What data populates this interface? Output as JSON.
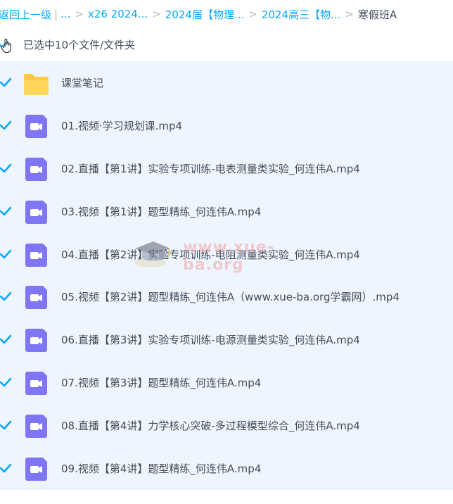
{
  "breadcrumb": {
    "back": "返回上一级",
    "ellipsis": "...",
    "items": [
      "x26 2024...",
      "2024届【物理...",
      "2024高三【物...",
      "寒假班A"
    ]
  },
  "selection": {
    "text": "已选中10个文件/文件夹"
  },
  "files": [
    {
      "name": "课堂笔记",
      "type": "folder"
    },
    {
      "name": "01.视频·学习规划课.mp4",
      "type": "video"
    },
    {
      "name": "02.直播【第1讲】实验专项训练-电表测量类实验_何连伟A.mp4",
      "type": "video"
    },
    {
      "name": "03.视频【第1讲】题型精练_何连伟A.mp4",
      "type": "video"
    },
    {
      "name": "04.直播【第2讲】实验专项训练-电阻测量类实验_何连伟A.mp4",
      "type": "video"
    },
    {
      "name": "05.视频【第2讲】题型精练_何连伟A（www.xue-ba.org学霸网）.mp4",
      "type": "video"
    },
    {
      "name": "06.直播【第3讲】实验专项训练-电源测量类实验_何连伟A.mp4",
      "type": "video"
    },
    {
      "name": "07.视频【第3讲】题型精练_何连伟A.mp4",
      "type": "video"
    },
    {
      "name": "08.直播【第4讲】力学核心突破-多过程模型综合_何连伟A.mp4",
      "type": "video"
    },
    {
      "name": "09.视频【第4讲】题型精练_何连伟A.mp4",
      "type": "video"
    }
  ],
  "watermark": {
    "text": "www.xue-ba.org"
  },
  "colors": {
    "link": "#06a7ff",
    "check": "#06a7ff",
    "row_selected": "#eef5ff",
    "video_icon": "#7f76f6",
    "folder": "#ffc83d"
  }
}
